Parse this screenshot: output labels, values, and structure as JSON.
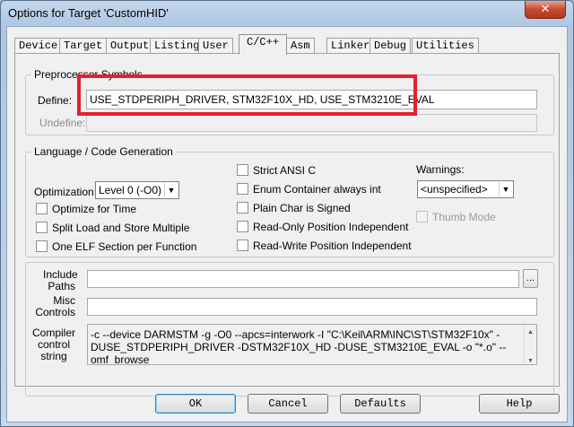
{
  "window": {
    "title": "Options for Target 'CustomHID'",
    "close_glyph": "✕"
  },
  "tabs": [
    {
      "label": "Device"
    },
    {
      "label": "Target"
    },
    {
      "label": "Output"
    },
    {
      "label": "Listing"
    },
    {
      "label": "User"
    },
    {
      "label": "C/C++"
    },
    {
      "label": "Asm"
    },
    {
      "label": "Linker"
    },
    {
      "label": "Debug"
    },
    {
      "label": "Utilities"
    }
  ],
  "active_tab": "C/C++",
  "preprocessor": {
    "group_title": "Preprocessor Symbols",
    "define_label": "Define:",
    "define_value": "USE_STDPERIPH_DRIVER, STM32F10X_HD, USE_STM3210E_EVAL",
    "undefine_label": "Undefine:",
    "undefine_value": ""
  },
  "language": {
    "group_title": "Language / Code Generation",
    "optimization_label": "Optimization:",
    "optimization_value": "Level 0 (-O0)",
    "optimize_for_time": "Optimize for Time",
    "split_load_store": "Split Load and Store Multiple",
    "one_elf_section": "One ELF Section per Function",
    "strict_ansi_c": "Strict ANSI C",
    "enum_container": "Enum Container always int",
    "plain_char_signed": "Plain Char is Signed",
    "read_only_pi": "Read-Only Position Independent",
    "read_write_pi": "Read-Write Position Independent",
    "warnings_label": "Warnings:",
    "warnings_value": "<unspecified>",
    "thumb_mode": "Thumb Mode"
  },
  "include": {
    "label_1": "Include",
    "label_2": "Paths",
    "value": "",
    "browse_label": "..."
  },
  "misc": {
    "label_1": "Misc",
    "label_2": "Controls",
    "value": ""
  },
  "compiler": {
    "label_1": "Compiler",
    "label_2": "control",
    "label_3": "string",
    "line_1": "-c --device DARMSTM -g -O0 --apcs=interwork -I \"C:\\Keil\\ARM\\INC\\ST\\STM32F10x\" -",
    "line_2": "DUSE_STDPERIPH_DRIVER -DSTM32F10X_HD -DUSE_STM3210E_EVAL -o \"*.o\" --omf_browse"
  },
  "buttons": {
    "ok": "OK",
    "cancel": "Cancel",
    "defaults": "Defaults",
    "help": "Help"
  },
  "colors": {
    "highlight_rect": "#e3212b",
    "title_bar": "#b9cfe7",
    "close_button": "#c74a33"
  }
}
